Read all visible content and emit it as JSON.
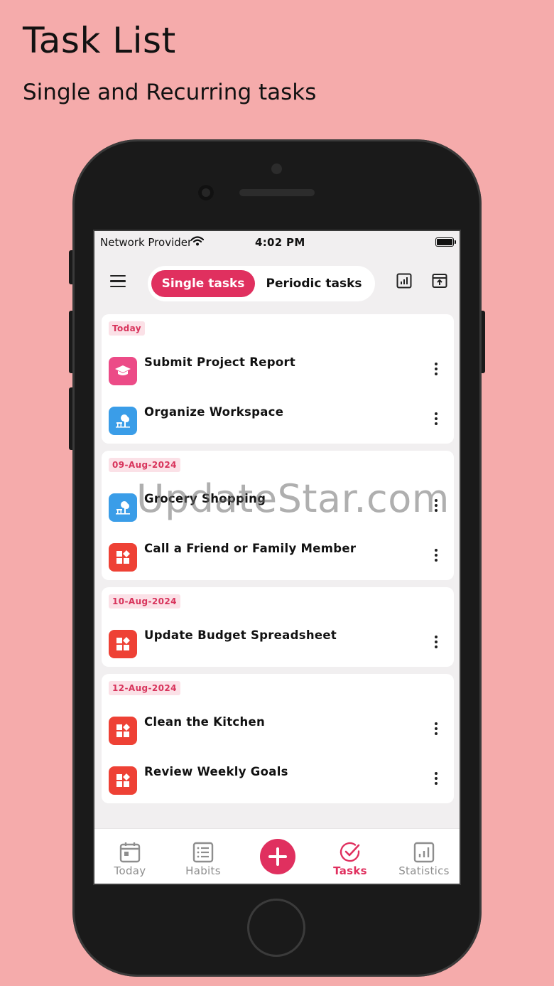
{
  "promo": {
    "title": "Task List",
    "subtitle": "Single and Recurring tasks"
  },
  "status_bar": {
    "carrier": "Network Provider",
    "time": "4:02 PM"
  },
  "header": {
    "menu_icon": "menu-icon",
    "segments": {
      "active": "Single tasks",
      "inactive": "Periodic tasks"
    },
    "right_icons": [
      "chart-icon",
      "archive-upload-icon"
    ]
  },
  "groups": [
    {
      "date": "Today",
      "tasks": [
        {
          "title": "Submit Project Report",
          "icon": "graduation-cap-icon",
          "color": "#ec4b87"
        },
        {
          "title": "Organize Workspace",
          "icon": "tree-bench-icon",
          "color": "#3a9de8"
        }
      ]
    },
    {
      "date": "09-Aug-2024",
      "tasks": [
        {
          "title": "Grocery Shopping",
          "icon": "tree-bench-icon",
          "color": "#3a9de8"
        },
        {
          "title": "Call a Friend or Family Member",
          "icon": "widgets-icon",
          "color": "#ee4135"
        }
      ]
    },
    {
      "date": "10-Aug-2024",
      "tasks": [
        {
          "title": "Update Budget Spreadsheet",
          "icon": "widgets-icon",
          "color": "#ee4135"
        }
      ]
    },
    {
      "date": "12-Aug-2024",
      "tasks": [
        {
          "title": "Clean the Kitchen",
          "icon": "widgets-icon",
          "color": "#ee4135"
        },
        {
          "title": "Review Weekly Goals",
          "icon": "widgets-icon",
          "color": "#ee4135"
        }
      ]
    }
  ],
  "tabbar": {
    "today": "Today",
    "habits": "Habits",
    "add": "add-icon",
    "tasks": "Tasks",
    "statistics": "Statistics",
    "active": "Tasks",
    "accent": "#e0305f"
  },
  "watermark": "UpdateStar.com"
}
